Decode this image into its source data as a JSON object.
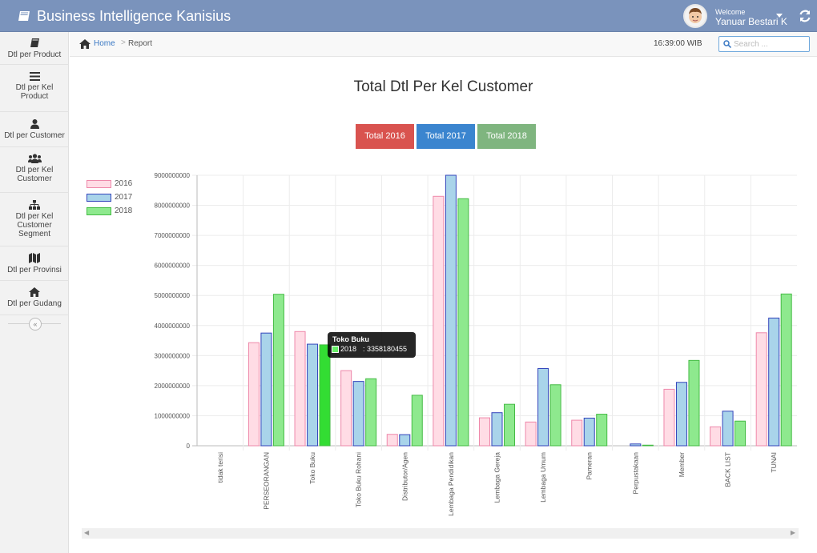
{
  "app": {
    "title": "Business Intelligence Kanisius",
    "welcome": "Welcome",
    "username": "Yanuar Bestari K"
  },
  "sidebar": {
    "items": [
      {
        "label": "Dtl per Product",
        "icon": "book-icon"
      },
      {
        "label": "Dtl per Kel Product",
        "icon": "list-icon"
      },
      {
        "label": "Dtl per Customer",
        "icon": "user-icon"
      },
      {
        "label": "Dtl per Kel Customer",
        "icon": "users-icon"
      },
      {
        "label": "Dtl per Kel Customer Segment",
        "icon": "sitemap-icon"
      },
      {
        "label": "Dtl per Provinsi",
        "icon": "map-icon"
      },
      {
        "label": "Dtl per Gudang",
        "icon": "home-icon"
      }
    ],
    "collapse": "«"
  },
  "breadcrumb": {
    "home": "Home",
    "separator": ">",
    "current": "Report"
  },
  "clock": "16:39:00 WIB",
  "search": {
    "placeholder": "Search ..."
  },
  "buttons": {
    "b2016": "Total 2016",
    "b2017": "Total 2017",
    "b2018": "Total 2018"
  },
  "tooltip": {
    "title": "Toko Buku",
    "series": "2018",
    "value": ": 3358180455"
  },
  "colors": {
    "navbar": "#7a93bc",
    "s2016_fill": "#ffdce5",
    "s2016_border": "#ee88aa",
    "s2017_fill": "#a9d4ea",
    "s2017_border": "#3344bb",
    "s2018_fill": "#8ee98e",
    "s2018_border": "#44bb44",
    "btn2016": "#d9534f",
    "btn2017": "#3b85cf",
    "btn2018": "#7fb57f"
  },
  "chart_data": {
    "type": "bar",
    "title": "Total Dtl Per Kel Customer",
    "xlabel": "",
    "ylabel": "",
    "ylim": [
      0,
      9000000000
    ],
    "yticks": [
      "0",
      "1000000000",
      "2000000000",
      "3000000000",
      "4000000000",
      "5000000000",
      "6000000000",
      "7000000000",
      "8000000000",
      "9000000000"
    ],
    "grid": true,
    "legend_position": "top-left",
    "categories": [
      "tidak terisi",
      "PERSEORANGAN",
      "Toko Buku",
      "Toko Buku Rohani",
      "Distributor/Agen",
      "Lembaga Pendidikan",
      "Lembaga Gereja",
      "Lembaga Umum",
      "Pameran",
      "Perpustakaan",
      "Member",
      "BACK LIST",
      "TUNAI"
    ],
    "series": [
      {
        "name": "2016",
        "values": [
          0,
          3430000000,
          3800000000,
          2500000000,
          380000000,
          8300000000,
          930000000,
          790000000,
          850000000,
          0,
          1880000000,
          630000000,
          3760000000
        ]
      },
      {
        "name": "2017",
        "values": [
          0,
          3750000000,
          3380000000,
          2140000000,
          370000000,
          9000000000,
          1100000000,
          2570000000,
          920000000,
          60000000,
          2110000000,
          1150000000,
          4250000000
        ]
      },
      {
        "name": "2018",
        "values": [
          0,
          5040000000,
          3358180455,
          2230000000,
          1680000000,
          8220000000,
          1380000000,
          2030000000,
          1050000000,
          20000000,
          2840000000,
          820000000,
          5050000000
        ]
      }
    ]
  }
}
